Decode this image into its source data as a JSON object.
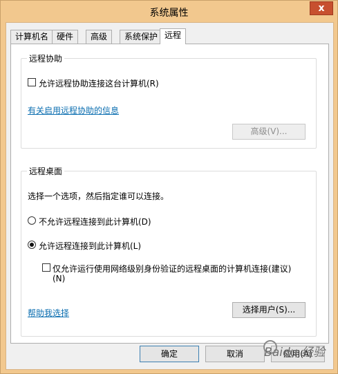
{
  "window": {
    "title": "系统属性",
    "close_glyph": "x"
  },
  "tabs": [
    {
      "label": "计算机名"
    },
    {
      "label": "硬件"
    },
    {
      "label": "高级"
    },
    {
      "label": "系统保护"
    },
    {
      "label": "远程",
      "active": true
    }
  ],
  "remote_assistance": {
    "group_title": "远程协助",
    "checkbox_label": "允许远程协助连接这台计算机(R)",
    "checked": false,
    "info_link": "有关启用远程协助的信息",
    "advanced_button": "高级(V)..."
  },
  "remote_desktop": {
    "group_title": "远程桌面",
    "instruction": "选择一个选项，然后指定谁可以连接。",
    "option_disallow": "不允许远程连接到此计算机(D)",
    "option_allow": "允许远程连接到此计算机(L)",
    "selected": "allow",
    "nla_label_line1": "仅允许运行使用网络级别身份验证的远程桌面的计算机连接(建议)",
    "nla_label_line2": "(N)",
    "nla_checked": false,
    "help_link": "帮助我选择",
    "select_users_button": "选择用户(S)..."
  },
  "footer": {
    "ok_button": "确定",
    "cancel_button": "取消",
    "apply_button": "应用(A)"
  },
  "watermark_text": "Baidu 经验"
}
